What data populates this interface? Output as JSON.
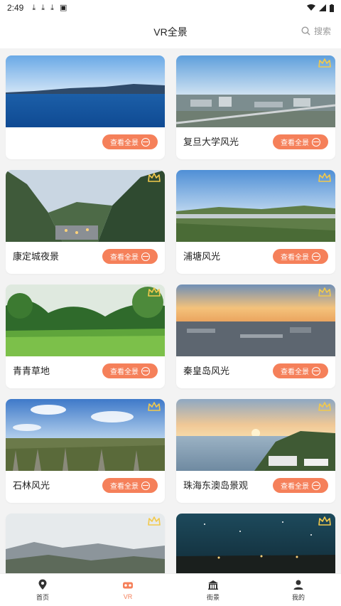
{
  "status": {
    "time": "2:49"
  },
  "header": {
    "title": "VR全景",
    "search_label": "搜索"
  },
  "cards": [
    {
      "caption": "",
      "button": "查看全景",
      "premium": false
    },
    {
      "caption": "复旦大学风光",
      "button": "查看全景",
      "premium": true
    },
    {
      "caption": "康定城夜景",
      "button": "查看全景",
      "premium": true
    },
    {
      "caption": "浦塘风光",
      "button": "查看全景",
      "premium": true
    },
    {
      "caption": "青青草地",
      "button": "查看全景",
      "premium": true
    },
    {
      "caption": "秦皇岛风光",
      "button": "查看全景",
      "premium": true
    },
    {
      "caption": "石林风光",
      "button": "查看全景",
      "premium": true
    },
    {
      "caption": "珠海东澳岛景观",
      "button": "查看全景",
      "premium": true
    },
    {
      "caption": "",
      "button": "",
      "premium": true
    },
    {
      "caption": "",
      "button": "",
      "premium": true
    }
  ],
  "tabs": [
    {
      "label": "首页",
      "icon": "location-pin-icon"
    },
    {
      "label": "VR",
      "icon": "vr-headset-icon",
      "active": true
    },
    {
      "label": "街景",
      "icon": "building-icon"
    },
    {
      "label": "我的",
      "icon": "person-icon"
    }
  ],
  "colors": {
    "accent": "#f5805a",
    "crown": "#f2c94c"
  }
}
